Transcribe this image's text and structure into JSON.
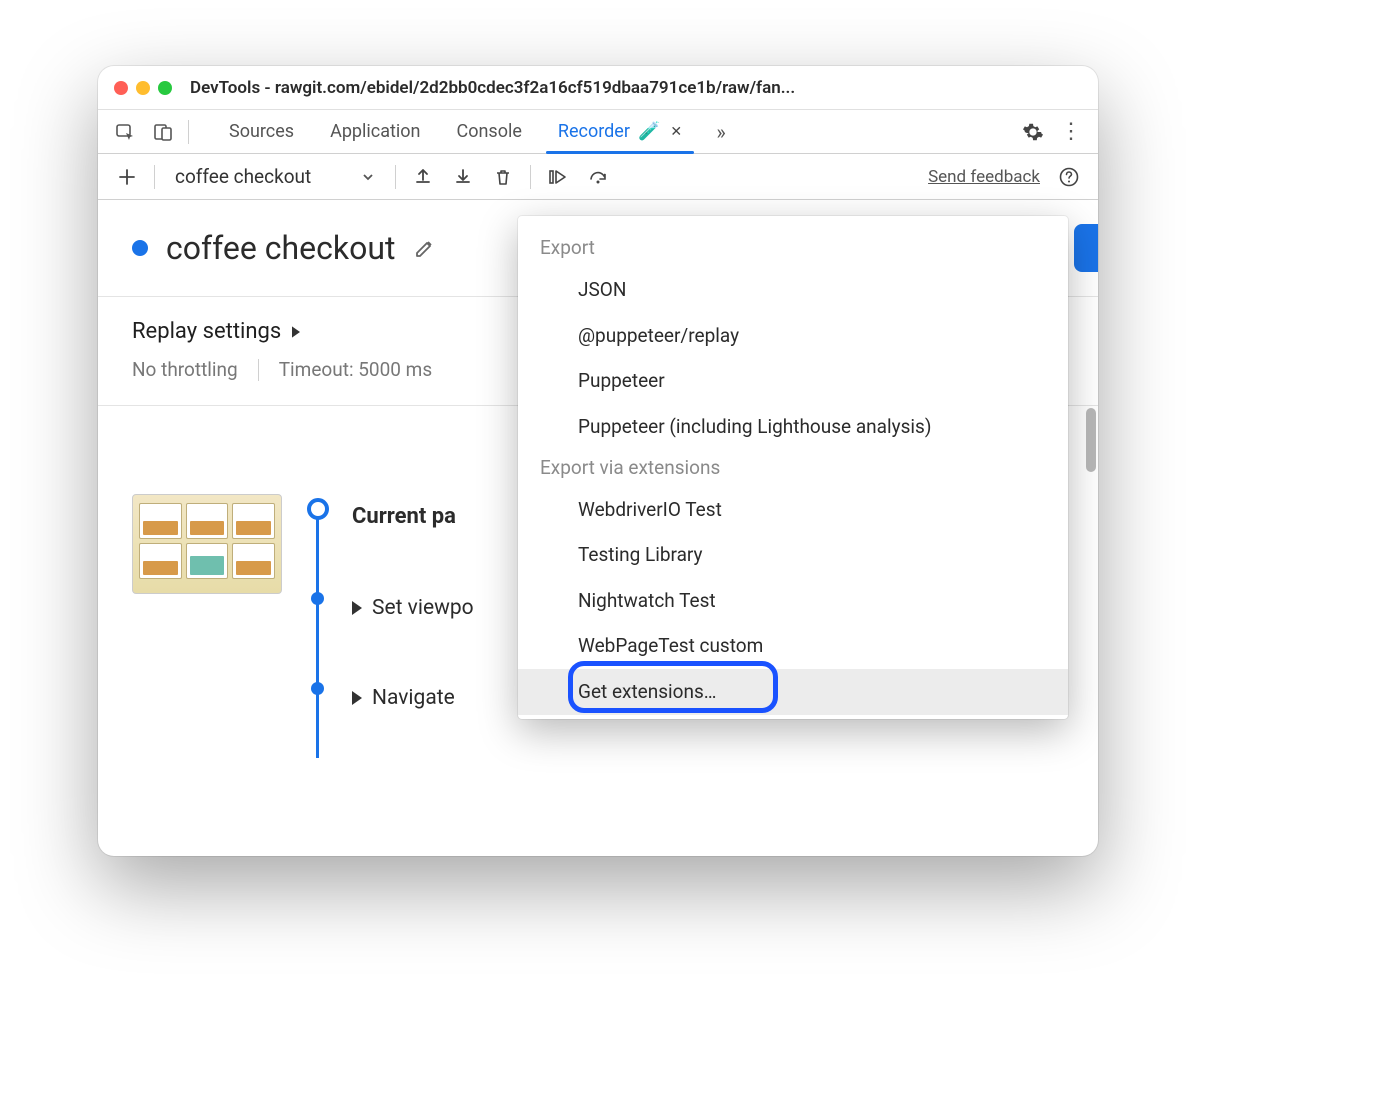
{
  "window": {
    "title": "DevTools - rawgit.com/ebidel/2d2bb0cdec3f2a16cf519dbaa791ce1b/raw/fan..."
  },
  "tabs": {
    "items": [
      "Sources",
      "Application",
      "Console",
      "Recorder"
    ],
    "active_index": 3,
    "experiment_badge": "🧪"
  },
  "toolbar": {
    "recording_name": "coffee checkout",
    "feedback_link": "Send feedback"
  },
  "recording": {
    "title": "coffee checkout"
  },
  "replay": {
    "header": "Replay settings",
    "throttling": "No throttling",
    "timeout": "Timeout: 5000 ms"
  },
  "steps": {
    "current": "Current pa",
    "rows": [
      "Set viewpo",
      "Navigate"
    ]
  },
  "export_menu": {
    "section1_label": "Export",
    "section1_items": [
      "JSON",
      "@puppeteer/replay",
      "Puppeteer",
      "Puppeteer (including Lighthouse analysis)"
    ],
    "section2_label": "Export via extensions",
    "section2_items": [
      "WebdriverIO Test",
      "Testing Library",
      "Nightwatch Test",
      "WebPageTest custom",
      "Get extensions…"
    ],
    "highlighted_index": 4
  }
}
